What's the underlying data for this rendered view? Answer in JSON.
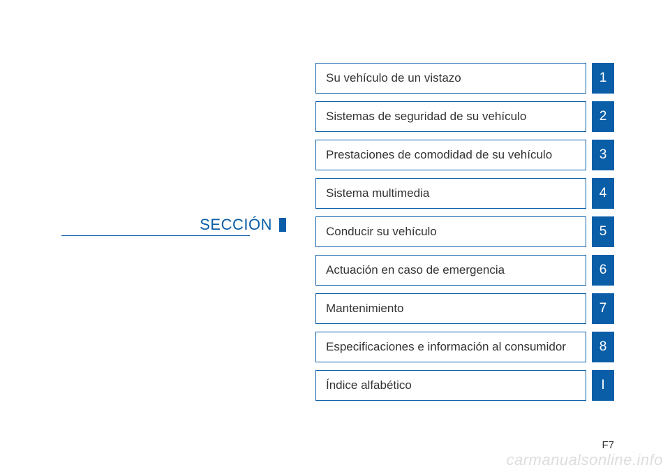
{
  "section_heading": "SECCIÓN",
  "toc": [
    {
      "label": "Su vehículo de un vistazo",
      "num": "1"
    },
    {
      "label": "Sistemas de seguridad de su vehículo",
      "num": "2"
    },
    {
      "label": "Prestaciones de comodidad de su vehículo",
      "num": "3"
    },
    {
      "label": "Sistema multimedia",
      "num": "4"
    },
    {
      "label": "Conducir su vehículo",
      "num": "5"
    },
    {
      "label": "Actuación en caso de emergencia",
      "num": "6"
    },
    {
      "label": "Mantenimiento",
      "num": "7"
    },
    {
      "label": "Especificaciones e información al consumidor",
      "num": "8"
    },
    {
      "label": "Índice alfabético",
      "num": "I"
    }
  ],
  "page_number": "F7",
  "watermark": "carmanualsonline.info"
}
